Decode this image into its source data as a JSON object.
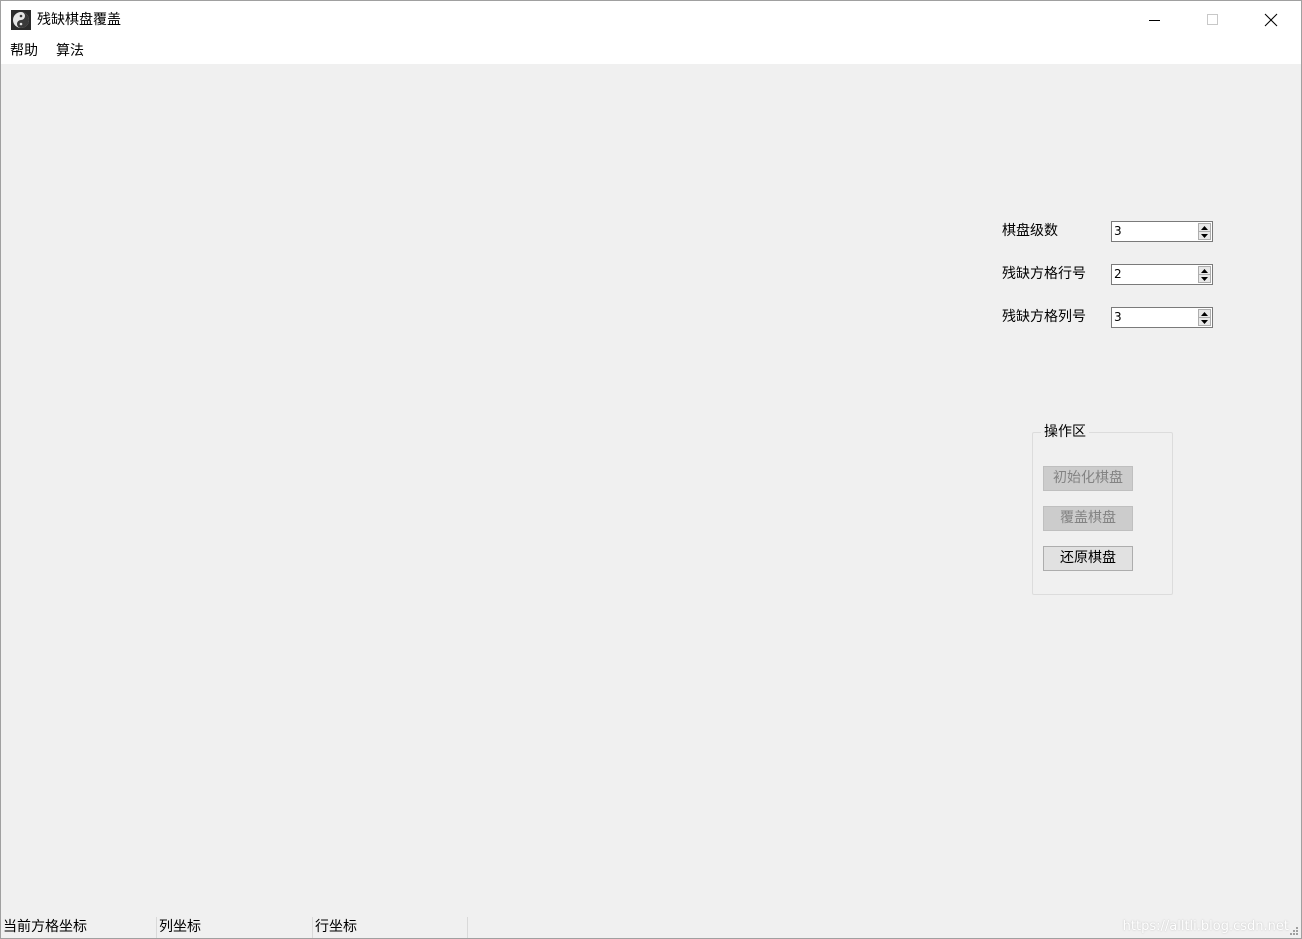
{
  "window": {
    "title": "残缺棋盘覆盖"
  },
  "menu": {
    "help": "帮助",
    "algorithm": "算法"
  },
  "params": {
    "board_level_label": "棋盘级数",
    "board_level_value": "3",
    "missing_row_label": "残缺方格行号",
    "missing_row_value": "2",
    "missing_col_label": "残缺方格列号",
    "missing_col_value": "3"
  },
  "operations": {
    "group_title": "操作区",
    "init_button": "初始化棋盘",
    "cover_button": "覆盖棋盘",
    "restore_button": "还原棋盘"
  },
  "status": {
    "current_cell": "当前方格坐标",
    "column_coord": "列坐标",
    "row_coord": "行坐标",
    "watermark": "https://alltli.blog.csdn.net"
  }
}
